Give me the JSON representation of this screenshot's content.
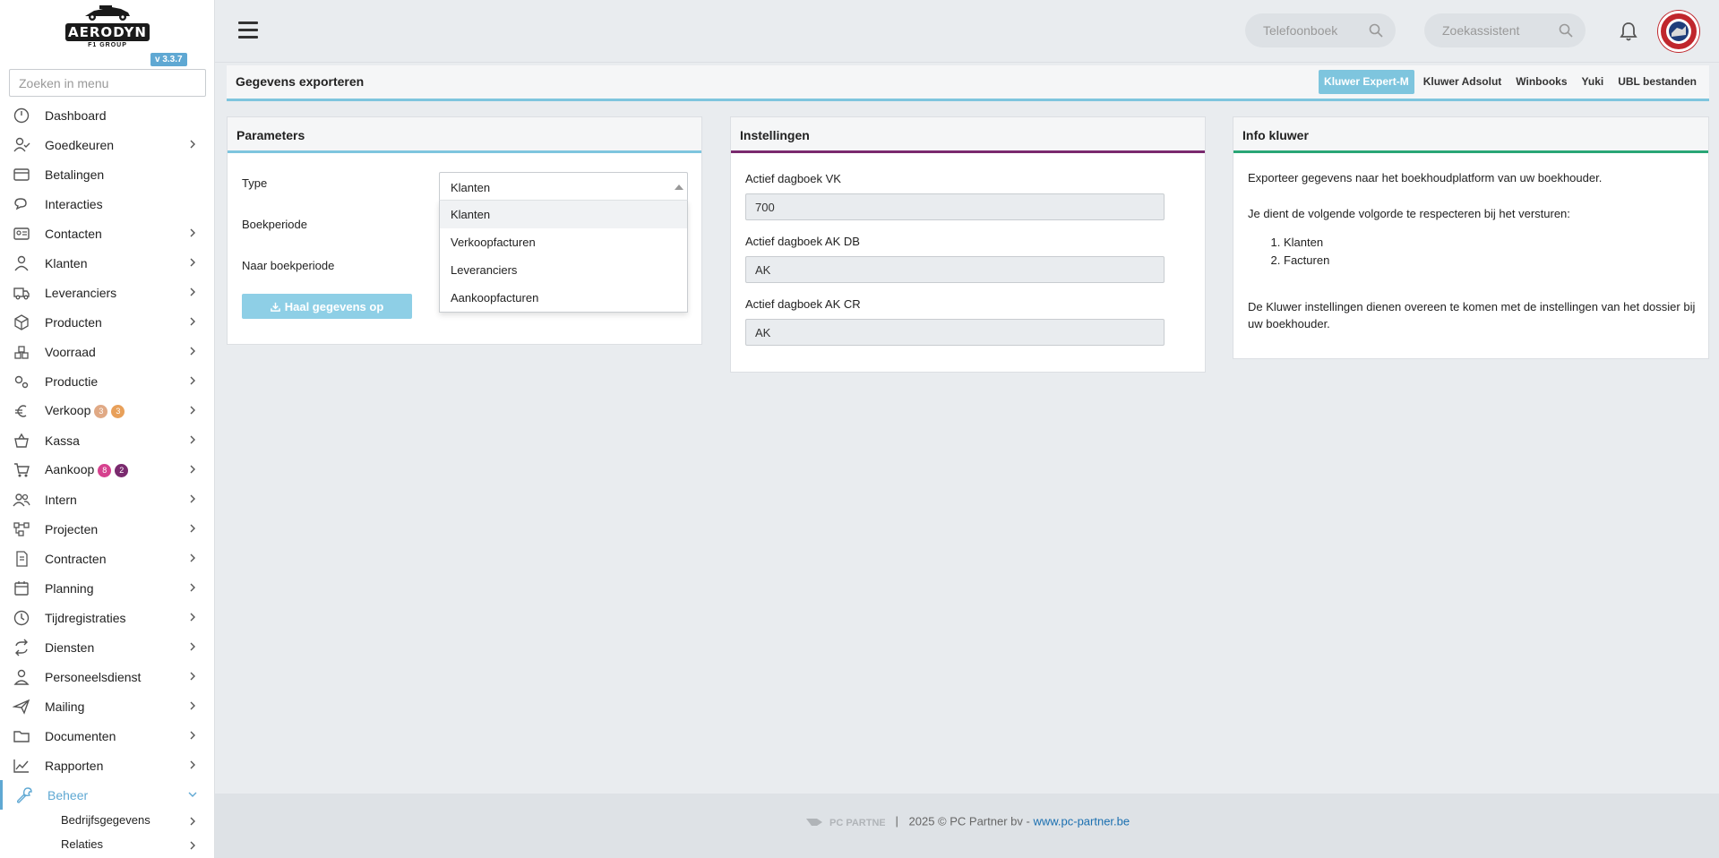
{
  "brand": {
    "logo_text": "AERODYN",
    "logo_sub": "F1 GROUP",
    "version": "v 3.3.7"
  },
  "sidebar": {
    "search_placeholder": "Zoeken in menu",
    "items": [
      {
        "label": "Dashboard",
        "icon": "dashboard-icon",
        "chevron": false
      },
      {
        "label": "Goedkeuren",
        "icon": "user-check-icon",
        "chevron": true
      },
      {
        "label": "Betalingen",
        "icon": "credit-card-icon",
        "chevron": false
      },
      {
        "label": "Interacties",
        "icon": "chat-icon",
        "chevron": false
      },
      {
        "label": "Contacten",
        "icon": "contact-card-icon",
        "chevron": true
      },
      {
        "label": "Klanten",
        "icon": "customer-icon",
        "chevron": true
      },
      {
        "label": "Leveranciers",
        "icon": "truck-icon",
        "chevron": true
      },
      {
        "label": "Producten",
        "icon": "box-icon",
        "chevron": true
      },
      {
        "label": "Voorraad",
        "icon": "stock-icon",
        "chevron": true
      },
      {
        "label": "Productie",
        "icon": "gears-icon",
        "chevron": true
      },
      {
        "label": "Verkoop",
        "icon": "euro-icon",
        "chevron": true,
        "badges": [
          {
            "value": "3",
            "color": "#e0a985"
          },
          {
            "value": "3",
            "color": "#e8a05a"
          }
        ]
      },
      {
        "label": "Kassa",
        "icon": "basket-icon",
        "chevron": true
      },
      {
        "label": "Aankoop",
        "icon": "cart-icon",
        "chevron": true,
        "badges": [
          {
            "value": "8",
            "color": "#d6418e"
          },
          {
            "value": "2",
            "color": "#7a2a6e"
          }
        ]
      },
      {
        "label": "Intern",
        "icon": "users-icon",
        "chevron": true
      },
      {
        "label": "Projecten",
        "icon": "project-icon",
        "chevron": true
      },
      {
        "label": "Contracten",
        "icon": "contract-icon",
        "chevron": true
      },
      {
        "label": "Planning",
        "icon": "calendar-icon",
        "chevron": true
      },
      {
        "label": "Tijdregistraties",
        "icon": "clock-icon",
        "chevron": true
      },
      {
        "label": "Diensten",
        "icon": "sync-icon",
        "chevron": true
      },
      {
        "label": "Personeelsdienst",
        "icon": "personnel-icon",
        "chevron": true
      },
      {
        "label": "Mailing",
        "icon": "paper-plane-icon",
        "chevron": true
      },
      {
        "label": "Documenten",
        "icon": "folder-icon",
        "chevron": true
      },
      {
        "label": "Rapporten",
        "icon": "chart-line-icon",
        "chevron": true
      },
      {
        "label": "Beheer",
        "icon": "wrench-icon",
        "chevron": true,
        "active": true
      }
    ],
    "sub_items": [
      "Bedrijfsgegevens",
      "Relaties"
    ]
  },
  "topbar": {
    "phonebook_placeholder": "Telefoonboek",
    "search_placeholder": "Zoekassistent"
  },
  "page": {
    "title": "Gegevens exporteren",
    "tabs": [
      {
        "label": "Kluwer Expert-M",
        "active": true
      },
      {
        "label": "Kluwer Adsolut",
        "active": false
      },
      {
        "label": "Winbooks",
        "active": false
      },
      {
        "label": "Yuki",
        "active": false
      },
      {
        "label": "UBL bestanden",
        "active": false
      }
    ]
  },
  "parameters": {
    "title": "Parameters",
    "type_label": "Type",
    "period_label": "Boekperiode",
    "to_period_label": "Naar boekperiode",
    "type_value": "Klanten",
    "options": [
      "Klanten",
      "Verkoopfacturen",
      "Leveranciers",
      "Aankoopfacturen"
    ],
    "fetch_button": "Haal gegevens op"
  },
  "settings": {
    "title": "Instellingen",
    "fields": [
      {
        "label": "Actief dagboek VK",
        "value": "700"
      },
      {
        "label": "Actief dagboek AK DB",
        "value": "AK"
      },
      {
        "label": "Actief dagboek AK CR",
        "value": "AK"
      }
    ]
  },
  "info": {
    "title": "Info kluwer",
    "intro": "Exporteer gegevens naar het boekhoudplatform van uw boekhouder.",
    "order_text": "Je dient de volgende volgorde te respecteren bij het versturen:",
    "order_items": [
      "Klanten",
      "Facturen"
    ],
    "note": "De Kluwer instellingen dienen overeen te komen met de instellingen van het dossier bij uw boekhouder."
  },
  "footer": {
    "logo_text": "PC PARTNER",
    "separator": "|",
    "copyright": "2025 © PC Partner bv -",
    "link": "www.pc-partner.be"
  },
  "colors": {
    "accent": "#7ec5de",
    "settings_accent": "#7a2a6e",
    "info_accent": "#2aa676",
    "active_menu": "#5fa8d3"
  }
}
